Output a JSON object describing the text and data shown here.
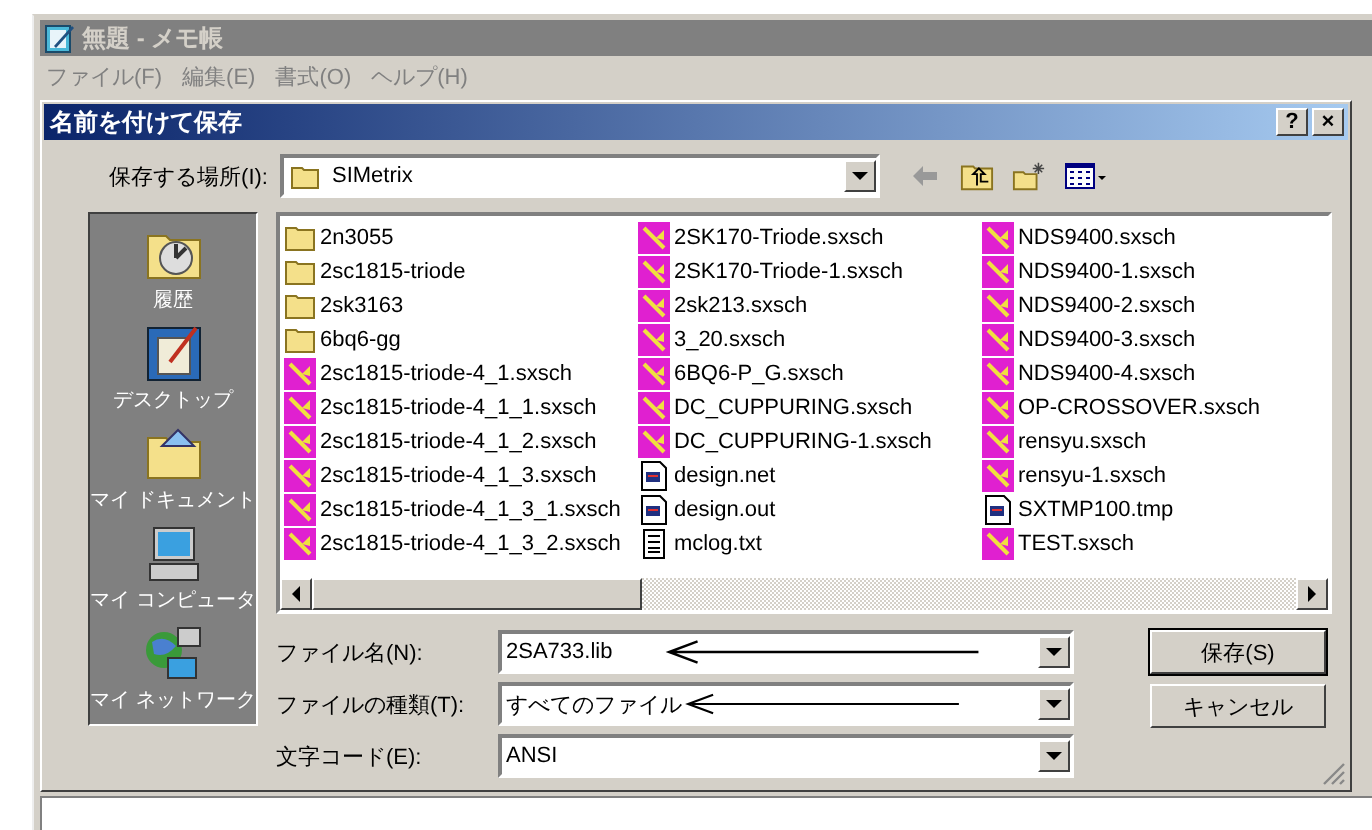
{
  "window": {
    "title": "無題 - メモ帳"
  },
  "menu": [
    "ファイル(F)",
    "編集(E)",
    "書式(O)",
    "ヘルプ(H)"
  ],
  "dialog": {
    "title": "名前を付けて保存",
    "help_button": "?",
    "close_button": "×",
    "location_label": "保存する場所(I):",
    "location": "SIMetrix",
    "places": [
      {
        "label": "履歴",
        "kind": "history"
      },
      {
        "label": "デスクトップ",
        "kind": "desktop"
      },
      {
        "label": "マイ ドキュメント",
        "kind": "documents"
      },
      {
        "label": "マイ コンピュータ",
        "kind": "computer"
      },
      {
        "label": "マイ ネットワーク",
        "kind": "network"
      }
    ],
    "files": [
      [
        {
          "name": "2n3055",
          "kind": "folder"
        },
        {
          "name": "2sc1815-triode",
          "kind": "folder"
        },
        {
          "name": "2sk3163",
          "kind": "folder"
        },
        {
          "name": "6bq6-gg",
          "kind": "folder"
        },
        {
          "name": "2sc1815-triode-4_1.sxsch",
          "kind": "schematic"
        },
        {
          "name": "2sc1815-triode-4_1_1.sxsch",
          "kind": "schematic"
        },
        {
          "name": "2sc1815-triode-4_1_2.sxsch",
          "kind": "schematic"
        },
        {
          "name": "2sc1815-triode-4_1_3.sxsch",
          "kind": "schematic"
        },
        {
          "name": "2sc1815-triode-4_1_3_1.sxsch",
          "kind": "schematic"
        },
        {
          "name": "2sc1815-triode-4_1_3_2.sxsch",
          "kind": "schematic"
        }
      ],
      [
        {
          "name": "2SK170-Triode.sxsch",
          "kind": "schematic"
        },
        {
          "name": "2SK170-Triode-1.sxsch",
          "kind": "schematic"
        },
        {
          "name": "2sk213.sxsch",
          "kind": "schematic"
        },
        {
          "name": "3_20.sxsch",
          "kind": "schematic"
        },
        {
          "name": "6BQ6-P_G.sxsch",
          "kind": "schematic"
        },
        {
          "name": "DC_CUPPURING.sxsch",
          "kind": "schematic"
        },
        {
          "name": "DC_CUPPURING-1.sxsch",
          "kind": "schematic"
        },
        {
          "name": "design.net",
          "kind": "document"
        },
        {
          "name": "design.out",
          "kind": "document"
        },
        {
          "name": "mclog.txt",
          "kind": "text"
        }
      ],
      [
        {
          "name": "NDS9400.sxsch",
          "kind": "schematic"
        },
        {
          "name": "NDS9400-1.sxsch",
          "kind": "schematic"
        },
        {
          "name": "NDS9400-2.sxsch",
          "kind": "schematic"
        },
        {
          "name": "NDS9400-3.sxsch",
          "kind": "schematic"
        },
        {
          "name": "NDS9400-4.sxsch",
          "kind": "schematic"
        },
        {
          "name": "OP-CROSSOVER.sxsch",
          "kind": "schematic"
        },
        {
          "name": "rensyu.sxsch",
          "kind": "schematic"
        },
        {
          "name": "rensyu-1.sxsch",
          "kind": "schematic"
        },
        {
          "name": "SXTMP100.tmp",
          "kind": "document"
        },
        {
          "name": "TEST.sxsch",
          "kind": "schematic"
        }
      ]
    ],
    "fields": [
      {
        "label": "ファイル名(N):",
        "value": "2SA733.lib",
        "annotated": true
      },
      {
        "label": "ファイルの種類(T):",
        "value": "すべてのファイル",
        "annotated": true
      },
      {
        "label": "文字コード(E):",
        "value": "ANSI",
        "annotated": false
      }
    ],
    "buttons": [
      "保存(S)",
      "キャンセル"
    ]
  }
}
